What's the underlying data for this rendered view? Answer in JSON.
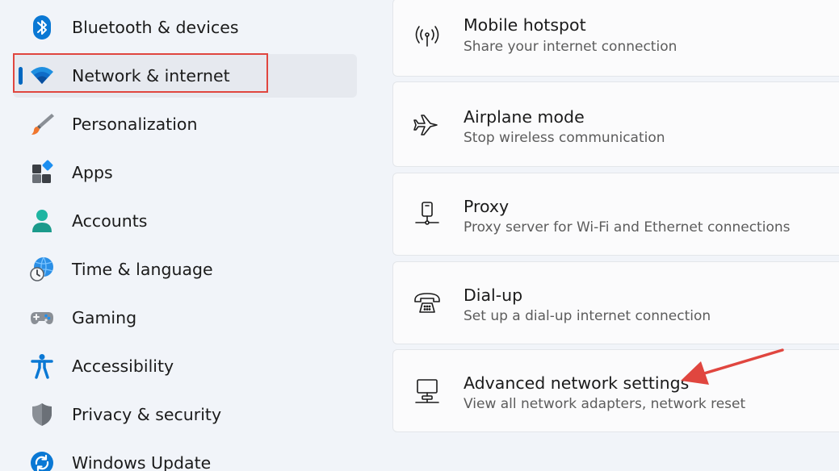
{
  "sidebar": {
    "items": [
      {
        "label": "Bluetooth & devices",
        "icon": "bluetooth-icon"
      },
      {
        "label": "Network & internet",
        "icon": "wifi-icon",
        "selected": true
      },
      {
        "label": "Personalization",
        "icon": "paintbrush-icon"
      },
      {
        "label": "Apps",
        "icon": "apps-icon"
      },
      {
        "label": "Accounts",
        "icon": "person-icon"
      },
      {
        "label": "Time & language",
        "icon": "globe-clock-icon"
      },
      {
        "label": "Gaming",
        "icon": "gamepad-icon"
      },
      {
        "label": "Accessibility",
        "icon": "accessibility-icon"
      },
      {
        "label": "Privacy & security",
        "icon": "shield-icon"
      },
      {
        "label": "Windows Update",
        "icon": "update-icon"
      }
    ]
  },
  "cards": [
    {
      "title": "Mobile hotspot",
      "subtitle": "Share your internet connection",
      "icon": "hotspot-icon"
    },
    {
      "title": "Airplane mode",
      "subtitle": "Stop wireless communication",
      "icon": "airplane-icon"
    },
    {
      "title": "Proxy",
      "subtitle": "Proxy server for Wi-Fi and Ethernet connections",
      "icon": "proxy-icon"
    },
    {
      "title": "Dial-up",
      "subtitle": "Set up a dial-up internet connection",
      "icon": "phone-icon"
    },
    {
      "title": "Advanced network settings",
      "subtitle": "View all network adapters, network reset",
      "icon": "network-computer-icon"
    }
  ],
  "colors": {
    "accent": "#0067c0",
    "annotation": "#e0463f",
    "background": "#f1f4f9",
    "card": "#fbfbfc"
  }
}
